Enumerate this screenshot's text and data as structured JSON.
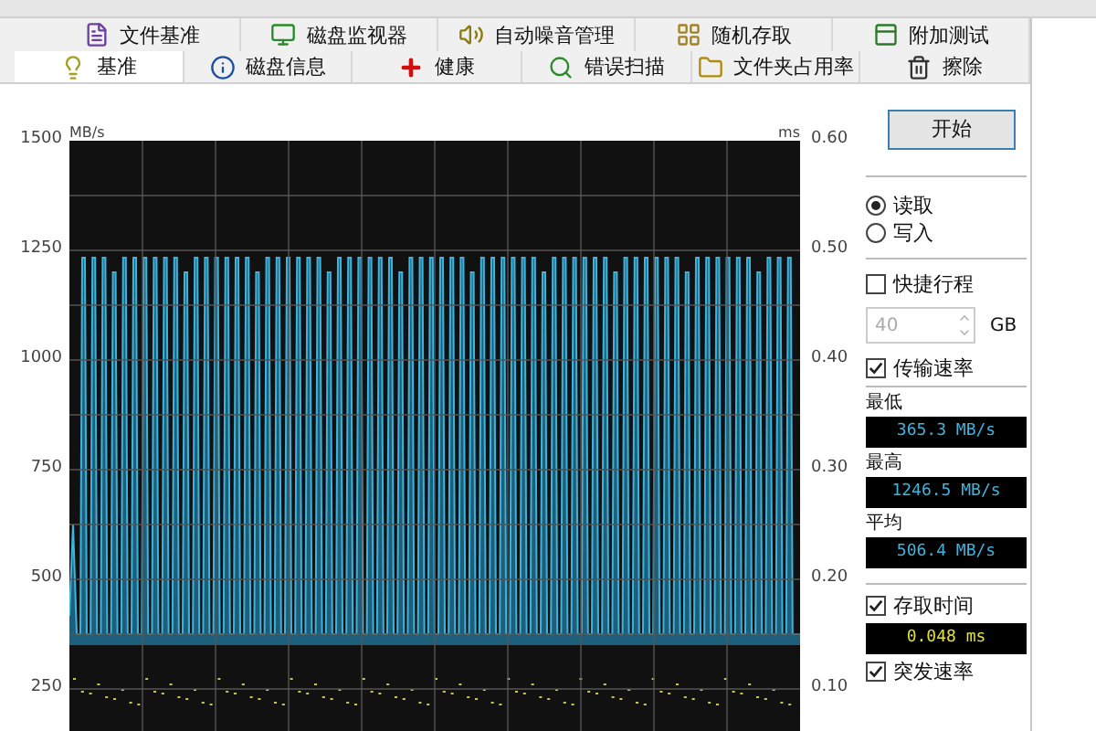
{
  "tabs_top": [
    {
      "label": "文件基准",
      "selected": false
    },
    {
      "label": "磁盘监视器",
      "selected": false
    },
    {
      "label": "自动噪音管理",
      "selected": false
    },
    {
      "label": "随机存取",
      "selected": false
    },
    {
      "label": "附加测试",
      "selected": false
    }
  ],
  "tabs_bottom": [
    {
      "label": "基准",
      "selected": true
    },
    {
      "label": "磁盘信息",
      "selected": false
    },
    {
      "label": "健康",
      "selected": false
    },
    {
      "label": "错误扫描",
      "selected": false
    },
    {
      "label": "文件夹占用率",
      "selected": false
    },
    {
      "label": "擦除",
      "selected": false
    }
  ],
  "chart": {
    "unit_left": "MB/s",
    "unit_right": "ms",
    "left_ticks": [
      "1500",
      "1250",
      "1000",
      "750",
      "500",
      "250"
    ],
    "right_ticks": [
      "0.60",
      "0.50",
      "0.40",
      "0.30",
      "0.20",
      "0.10"
    ]
  },
  "panel": {
    "start_button": "开始",
    "modes": [
      {
        "label": "读取",
        "selected": true
      },
      {
        "label": "写入",
        "selected": false
      }
    ],
    "short_stroke": {
      "label": "快捷行程",
      "checked": false
    },
    "stroke_size": {
      "value": "40",
      "disabled": true,
      "unit": "GB"
    },
    "transfer_rate": {
      "label": "传输速率",
      "checked": true
    },
    "readings": [
      {
        "label": "最低",
        "value": "365.3 MB/s"
      },
      {
        "label": "最高",
        "value": "1246.5 MB/s"
      },
      {
        "label": "平均",
        "value": "506.4 MB/s"
      }
    ],
    "access_time": {
      "label": "存取时间",
      "checked": true,
      "value": "0.048 ms"
    },
    "burst_rate": {
      "label": "突发速率",
      "checked": true
    }
  }
}
